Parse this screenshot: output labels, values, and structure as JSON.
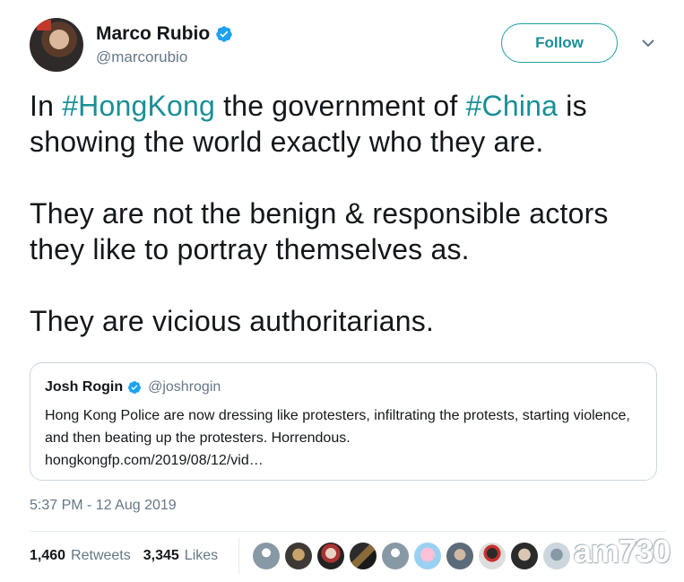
{
  "author": {
    "name": "Marco Rubio",
    "handle": "@marcorubio",
    "verified": true
  },
  "follow_label": "Follow",
  "tweet": {
    "paragraphs": [
      [
        {
          "text": "In ",
          "hashtag": false
        },
        {
          "text": "#HongKong",
          "hashtag": true
        },
        {
          "text": " the government of ",
          "hashtag": false
        },
        {
          "text": "#China",
          "hashtag": true
        },
        {
          "text": " is showing the world exactly who they are.",
          "hashtag": false
        }
      ],
      [
        {
          "text": "They are not the benign & responsible actors they like to portray themselves as.",
          "hashtag": false
        }
      ],
      [
        {
          "text": "They are vicious authoritarians.",
          "hashtag": false
        }
      ]
    ]
  },
  "quoted_tweet": {
    "name": "Josh Rogin",
    "handle": "@joshrogin",
    "verified": true,
    "text": "Hong Kong Police are now dressing like protesters, infiltrating the protests, starting violence, and then beating up the protesters. Horrendous.",
    "link": "hongkongfp.com/2019/08/12/vid…"
  },
  "timestamp": "5:37 PM - 12 Aug 2019",
  "stats": {
    "retweets_count": "1,460",
    "retweets_label": "Retweets",
    "likes_count": "3,345",
    "likes_label": "Likes"
  },
  "likers_count": 10,
  "watermark": "am730",
  "colors": {
    "accent": "#1a8f96",
    "verified": "#1da1f2",
    "muted": "#657786"
  }
}
